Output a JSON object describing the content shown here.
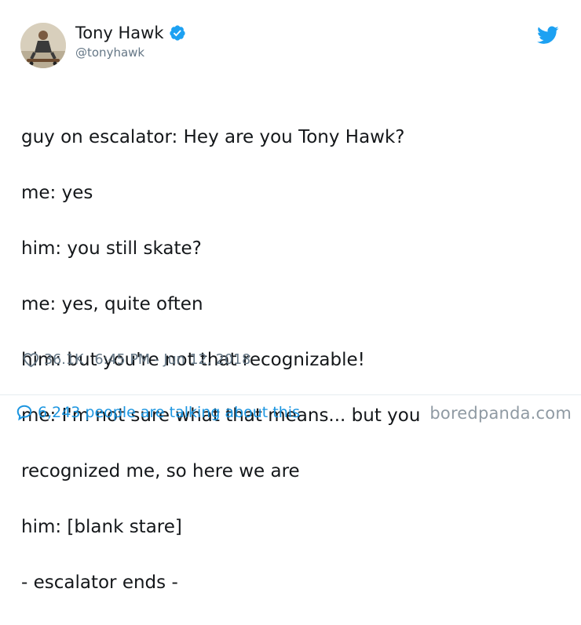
{
  "author": {
    "display_name": "Tony Hawk",
    "handle": "@tonyhawk",
    "avatar_icon": "profile-photo-skateboarder",
    "verified_icon": "verified-badge-icon"
  },
  "brand": {
    "icon": "twitter-bird-icon",
    "color": "#1da1f2"
  },
  "tweet": {
    "lines": [
      "guy on escalator: Hey are you Tony Hawk?",
      "me: yes",
      "him: you still skate?",
      "me: yes, quite often",
      "him: but you're not that recognizable!",
      "me: I'm not sure what that means... but you",
      "recognized me, so here we are",
      "him: [blank stare]",
      "- escalator ends -"
    ]
  },
  "meta": {
    "likes": "36.1K",
    "timestamp": "6:45 PM - Jun 12, 2018"
  },
  "conversation": {
    "text": "6,243 people are talking about this"
  },
  "watermark": "boredpanda.com",
  "colors": {
    "text": "#14171a",
    "muted": "#657786",
    "link": "#1b95e0",
    "divider": "#e6ecf0"
  }
}
